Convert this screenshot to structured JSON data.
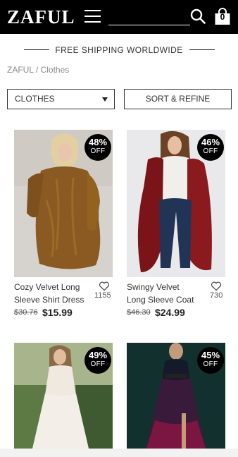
{
  "header": {
    "logo": "ZAFUL",
    "cart_count": "0"
  },
  "banner": {
    "text": "FREE SHIPPING WORLDWIDE"
  },
  "breadcrumb": "ZAFUL / Clothes",
  "filters": {
    "category_label": "CLOTHES",
    "sort_label": "SORT & REFINE"
  },
  "products": [
    {
      "discount": "48%",
      "off": "OFF",
      "title_line1": "Cozy Velvet Long",
      "title_line2": "Sleeve Shirt Dress",
      "likes": "1155",
      "old_price": "$30.76",
      "price": "$15.99"
    },
    {
      "discount": "46%",
      "off": "OFF",
      "title_line1": "Swingy Velvet",
      "title_line2": "Long Sleeve Coat",
      "likes": "730",
      "old_price": "$46.30",
      "price": "$24.99"
    },
    {
      "discount": "49%",
      "off": "OFF"
    },
    {
      "discount": "45%",
      "off": "OFF"
    }
  ],
  "colors": {
    "header_bg": "#000000",
    "badge_bg": "#000000",
    "text": "#222222"
  }
}
